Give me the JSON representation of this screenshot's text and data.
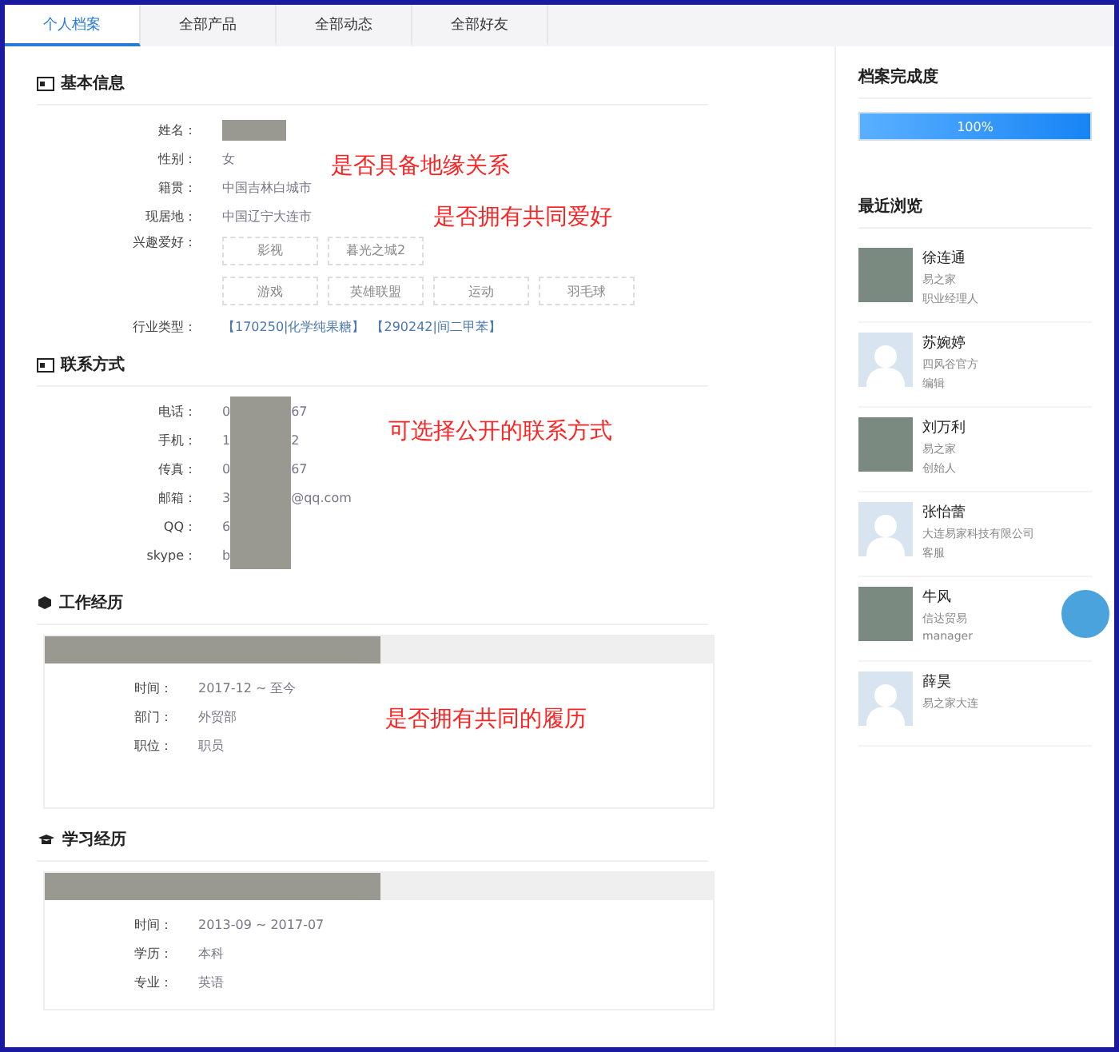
{
  "tabs": [
    {
      "label": "个人档案",
      "selected": true
    },
    {
      "label": "全部产品",
      "selected": false
    },
    {
      "label": "全部动态",
      "selected": false
    },
    {
      "label": "全部好友",
      "selected": false
    }
  ],
  "basic": {
    "title": "基本信息",
    "rows": [
      {
        "label": "姓名：",
        "kind": "redacted"
      },
      {
        "label": "性别：",
        "kind": "text",
        "value": "女"
      },
      {
        "label": "籍贯：",
        "kind": "text",
        "value": "中国吉林白城市"
      },
      {
        "label": "现居地：",
        "kind": "text",
        "value": "中国辽宁大连市"
      }
    ],
    "hobbies_label": "兴趣爱好：",
    "hobbies": [
      "影视",
      "暮光之城2",
      "游戏",
      "英雄联盟",
      "运动",
      "羽毛球"
    ],
    "industry_label": "行业类型：",
    "industries": [
      "【170250|化学纯果糖】",
      "【290242|间二甲苯】"
    ]
  },
  "contact": {
    "title": "联系方式",
    "rows": [
      {
        "label": "电话：",
        "start": "0",
        "end": "67"
      },
      {
        "label": "手机：",
        "start": "1",
        "end": "2"
      },
      {
        "label": "传真：",
        "start": "0",
        "end": "67"
      },
      {
        "label": "邮箱：",
        "start": "3",
        "end": "@qq.com"
      },
      {
        "label": "QQ：",
        "start": "6"
      },
      {
        "label": "skype：",
        "start": "b"
      }
    ]
  },
  "work": {
    "title": "工作经历",
    "rows": [
      {
        "label": "时间：",
        "value": "2017-12 ~ 至今"
      },
      {
        "label": "部门：",
        "value": "外贸部"
      },
      {
        "label": "职位：",
        "value": "职员"
      }
    ]
  },
  "education": {
    "title": "学习经历",
    "rows": [
      {
        "label": "时间：",
        "value": "2013-09 ~ 2017-07"
      },
      {
        "label": "学历：",
        "value": "本科"
      },
      {
        "label": "专业：",
        "value": "英语"
      }
    ]
  },
  "annotations": [
    "是否具备地缘关系",
    "是否拥有共同爱好",
    "可选择公开的联系方式",
    "是否拥有共同的履历"
  ],
  "completeness": {
    "title": "档案完成度",
    "level": 1,
    "reading": "100%"
  },
  "recent": {
    "title": "最近浏览",
    "items": [
      {
        "name": "徐连通",
        "company": "易之家",
        "role": "职业经理人",
        "kind": "photo"
      },
      {
        "name": "苏婉婷",
        "company": "四风谷官方",
        "role": "编辑",
        "kind": "silhouette"
      },
      {
        "name": "刘万利",
        "company": "易之家",
        "role": "创始人",
        "kind": "photo"
      },
      {
        "name": "张怡蕾",
        "company": "大连易家科技有限公司",
        "role": "客服",
        "kind": "silhouette"
      },
      {
        "name": "牛风",
        "company": "信达贸易",
        "role": "manager",
        "kind": "photo"
      },
      {
        "name": "薛昊",
        "company": "易之家大连",
        "kind": "silhouette"
      }
    ]
  }
}
